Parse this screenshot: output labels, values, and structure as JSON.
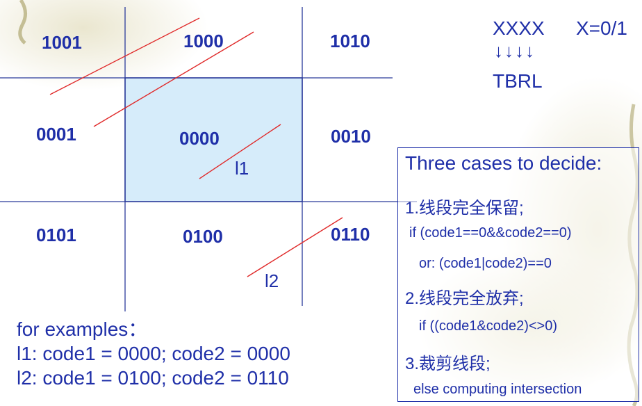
{
  "regions": {
    "top_left": "1001",
    "top_center": "1000",
    "top_right": "1010",
    "mid_left": "0001",
    "center": "0000",
    "mid_right": "0010",
    "bottom_left": "0101",
    "bottom_center": "0100",
    "bottom_right": "0110"
  },
  "line_labels": {
    "l1": "l1",
    "l2": "l2"
  },
  "legend": {
    "code": "XXXX",
    "values": "X=0/1",
    "arrows": "↓↓↓↓",
    "bits": "TBRL"
  },
  "examples": {
    "title": "for examples：",
    "l1": "l1: code1 = 0000; code2 = 0000",
    "l2": "l2: code1 = 0100; code2 = 0110"
  },
  "cases": {
    "title": "Three cases to decide:",
    "c1": "1.线段完全保留;",
    "c1_if": "if (code1==0&&code2==0)",
    "c1_or": "or: (code1|code2)==0",
    "c2": "2.线段完全放弃;",
    "c2_if": "if ((code1&code2)<>0)",
    "c3": "3.裁剪线段;",
    "c3_else": "else  computing intersection"
  },
  "colors": {
    "text": "#1f2fa8",
    "grid_line": "#2a3a9a",
    "segment": "#e02a2a",
    "window_fill": "#d6ecfa"
  }
}
